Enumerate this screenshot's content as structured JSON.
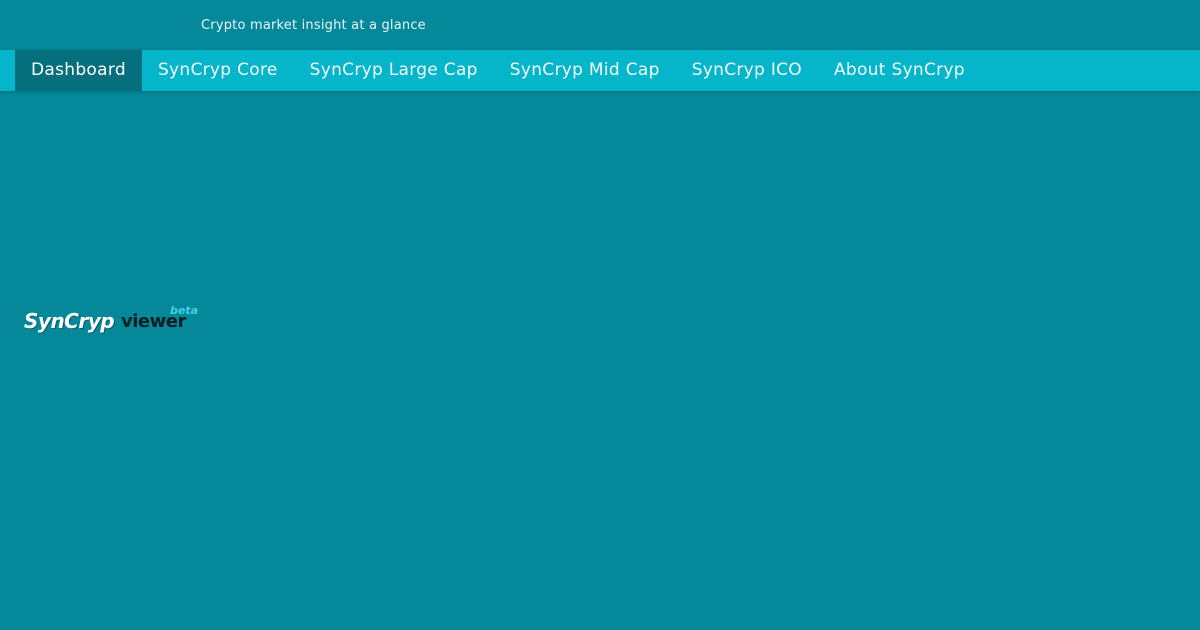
{
  "header": {
    "tagline": "Crypto market insight at a glance"
  },
  "nav": {
    "items": [
      {
        "label": "Dashboard",
        "active": true
      },
      {
        "label": "SynCryp Core",
        "active": false
      },
      {
        "label": "SynCryp Large Cap",
        "active": false
      },
      {
        "label": "SynCryp Mid Cap",
        "active": false
      },
      {
        "label": "SynCryp ICO",
        "active": false
      },
      {
        "label": "About SynCryp",
        "active": false
      }
    ]
  },
  "logo": {
    "brand": "SynCryp",
    "suffix": "viewer",
    "badge": "beta"
  },
  "colors": {
    "background": "#05889a",
    "navbar": "#05b6ca",
    "nav_active": "#066f7d",
    "beta_accent": "#41d3e6"
  }
}
